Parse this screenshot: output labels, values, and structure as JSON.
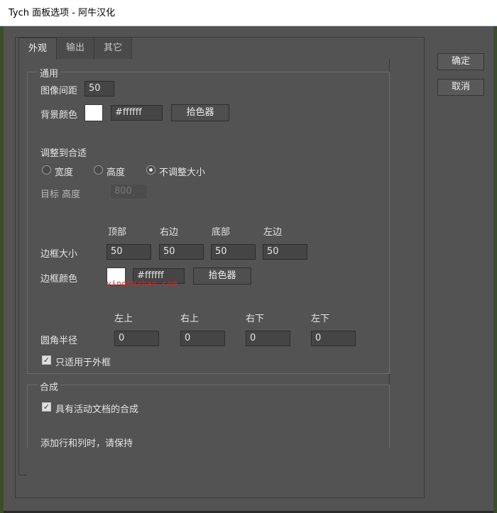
{
  "window": {
    "title": "Tych 面板选项 - 阿牛汉化"
  },
  "tabs": [
    {
      "label": "外观",
      "active": true
    },
    {
      "label": "输出",
      "active": false
    },
    {
      "label": "其它",
      "active": false
    }
  ],
  "side_buttons": {
    "ok": "确定",
    "cancel": "取消"
  },
  "general": {
    "legend": "通用",
    "spacing_label": "图像间距",
    "spacing_value": "50",
    "bg_color_label": "背景颜色",
    "bg_color_value": "#ffffff",
    "bg_color_swatch": "#ffffff",
    "picker_label": "拾色器",
    "fit_label": "调整到合适",
    "fit_options": [
      {
        "label": "宽度",
        "selected": false
      },
      {
        "label": "高度",
        "selected": false
      },
      {
        "label": "不调整大小",
        "selected": true
      }
    ],
    "target_label": "目标 高度",
    "target_value": "800",
    "border_headers": [
      "顶部",
      "右边",
      "底部",
      "左边"
    ],
    "border_size_label": "边框大小",
    "border_sizes": [
      "50",
      "50",
      "50",
      "50"
    ],
    "border_color_label": "边框颜色",
    "border_color_value": "#ffffff",
    "border_picker_label": "拾色器",
    "watermark": "yinghezhan.com",
    "corner_headers": [
      "左上",
      "右上",
      "右下",
      "左下"
    ],
    "corner_label": "圆角半径",
    "corner_values": [
      "0",
      "0",
      "0",
      "0"
    ],
    "outer_only_label": "只适用于外框",
    "outer_only_checked": true
  },
  "composite": {
    "legend": "合成",
    "active_doc_label": "具有活动文档的合成",
    "active_doc_checked": true,
    "hint": "添加行和列时，请保持"
  }
}
